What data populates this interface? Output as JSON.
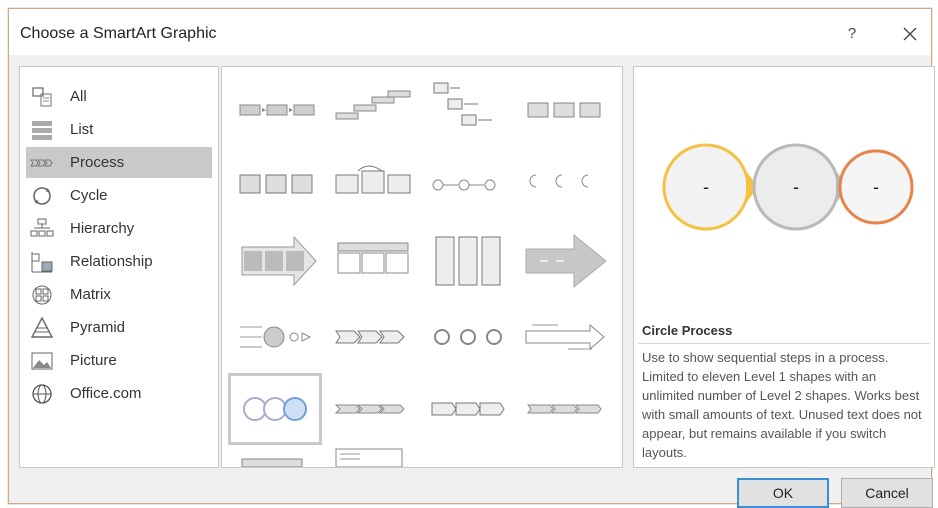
{
  "dialog": {
    "title": "Choose a SmartArt Graphic",
    "help_label": "?",
    "close_icon": "close-icon"
  },
  "categories": [
    {
      "label": "All",
      "icon": "all-icon",
      "selected": false
    },
    {
      "label": "List",
      "icon": "list-icon",
      "selected": false
    },
    {
      "label": "Process",
      "icon": "process-icon",
      "selected": true
    },
    {
      "label": "Cycle",
      "icon": "cycle-icon",
      "selected": false
    },
    {
      "label": "Hierarchy",
      "icon": "hierarchy-icon",
      "selected": false
    },
    {
      "label": "Relationship",
      "icon": "relationship-icon",
      "selected": false
    },
    {
      "label": "Matrix",
      "icon": "matrix-icon",
      "selected": false
    },
    {
      "label": "Pyramid",
      "icon": "pyramid-icon",
      "selected": false
    },
    {
      "label": "Picture",
      "icon": "picture-icon",
      "selected": false
    },
    {
      "label": "Office.com",
      "icon": "globe-icon",
      "selected": false
    }
  ],
  "gallery": {
    "selected_layout": "Circle Process",
    "scroll_up_label": "▲",
    "scroll_down_label": "▼"
  },
  "preview": {
    "title": "Circle Process",
    "description": "Use to show sequential steps in a process. Limited to eleven Level 1 shapes with an unlimited number of Level 2 shapes. Works best with small amounts of text. Unused text does not appear, but remains available if you switch layouts.",
    "circle_labels": [
      "-",
      "-",
      "-"
    ],
    "colors": {
      "circle1": "#f5c142",
      "circle2": "#b8b8b8",
      "circle3": "#e8844a"
    }
  },
  "buttons": {
    "ok_label": "OK",
    "cancel_label": "Cancel"
  }
}
